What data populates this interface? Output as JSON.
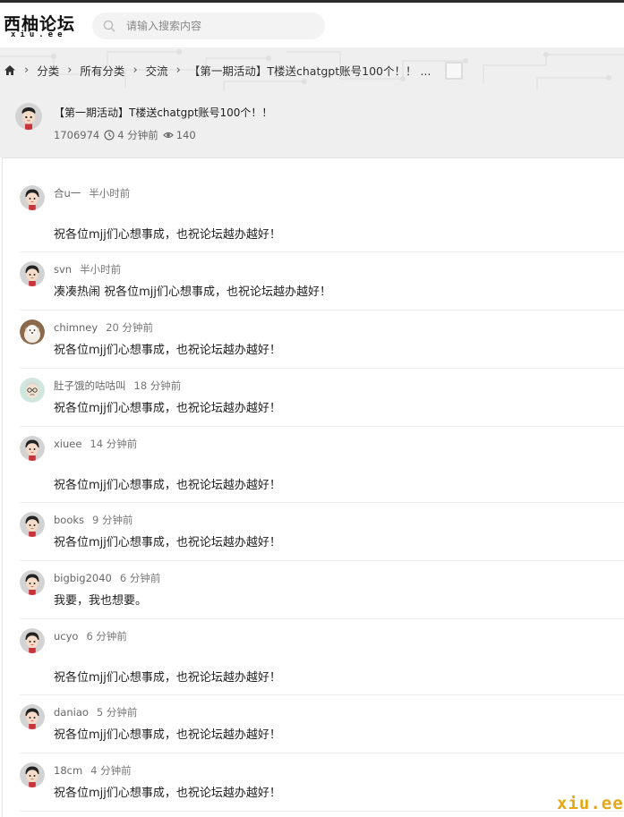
{
  "site": {
    "logo_main": "西柚论坛",
    "logo_sub": "xiu.ee",
    "watermark": "xiu.ee"
  },
  "search": {
    "placeholder": "请输入搜索内容"
  },
  "breadcrumb": {
    "items": [
      "分类",
      "所有分类",
      "交流",
      "【第一期活动】T楼送chatgpt账号100个！！ ..."
    ]
  },
  "topic": {
    "title": "【第一期活动】T楼送chatgpt账号100个！！",
    "id": "1706974",
    "time": "4 分钟前",
    "views": "140"
  },
  "posts": [
    {
      "user": "合u一",
      "time": "半小时前",
      "content": "祝各位mjj们心想事成，也祝论坛越办越好！",
      "avatar": "cartoon-avatar"
    },
    {
      "user": "svn",
      "time": "半小时前",
      "content": "凑凑热闹 祝各位mjj们心想事成，也祝论坛越办越好！",
      "avatar": "cartoon-avatar"
    },
    {
      "user": "chimney",
      "time": "20 分钟前",
      "content": "祝各位mjj们心想事成，也祝论坛越办越好！",
      "avatar": "dog-avatar"
    },
    {
      "user": "肚子饿的咕咕叫",
      "time": "18 分钟前",
      "content": "祝各位mjj们心想事成，也祝论坛越办越好！",
      "avatar": "glasses-avatar"
    },
    {
      "user": "xiuee",
      "time": "14 分钟前",
      "content": "祝各位mjj们心想事成，也祝论坛越办越好！",
      "avatar": "cartoon-avatar"
    },
    {
      "user": "books",
      "time": "9 分钟前",
      "content": "祝各位mjj们心想事成，也祝论坛越办越好！",
      "avatar": "cartoon-avatar"
    },
    {
      "user": "bigbig2040",
      "time": "6 分钟前",
      "content": "我要，我也想要。",
      "avatar": "cartoon-avatar"
    },
    {
      "user": "ucyo",
      "time": "6 分钟前",
      "content": "祝各位mjj们心想事成，也祝论坛越办越好！",
      "avatar": "cartoon-avatar"
    },
    {
      "user": "daniao",
      "time": "5 分钟前",
      "content": "祝各位mjj们心想事成，也祝论坛越办越好！",
      "avatar": "cartoon-avatar"
    },
    {
      "user": "18cm",
      "time": "4 分钟前",
      "content": "祝各位mjj们心想事成，也祝论坛越办越好！",
      "avatar": "cartoon-avatar"
    }
  ]
}
